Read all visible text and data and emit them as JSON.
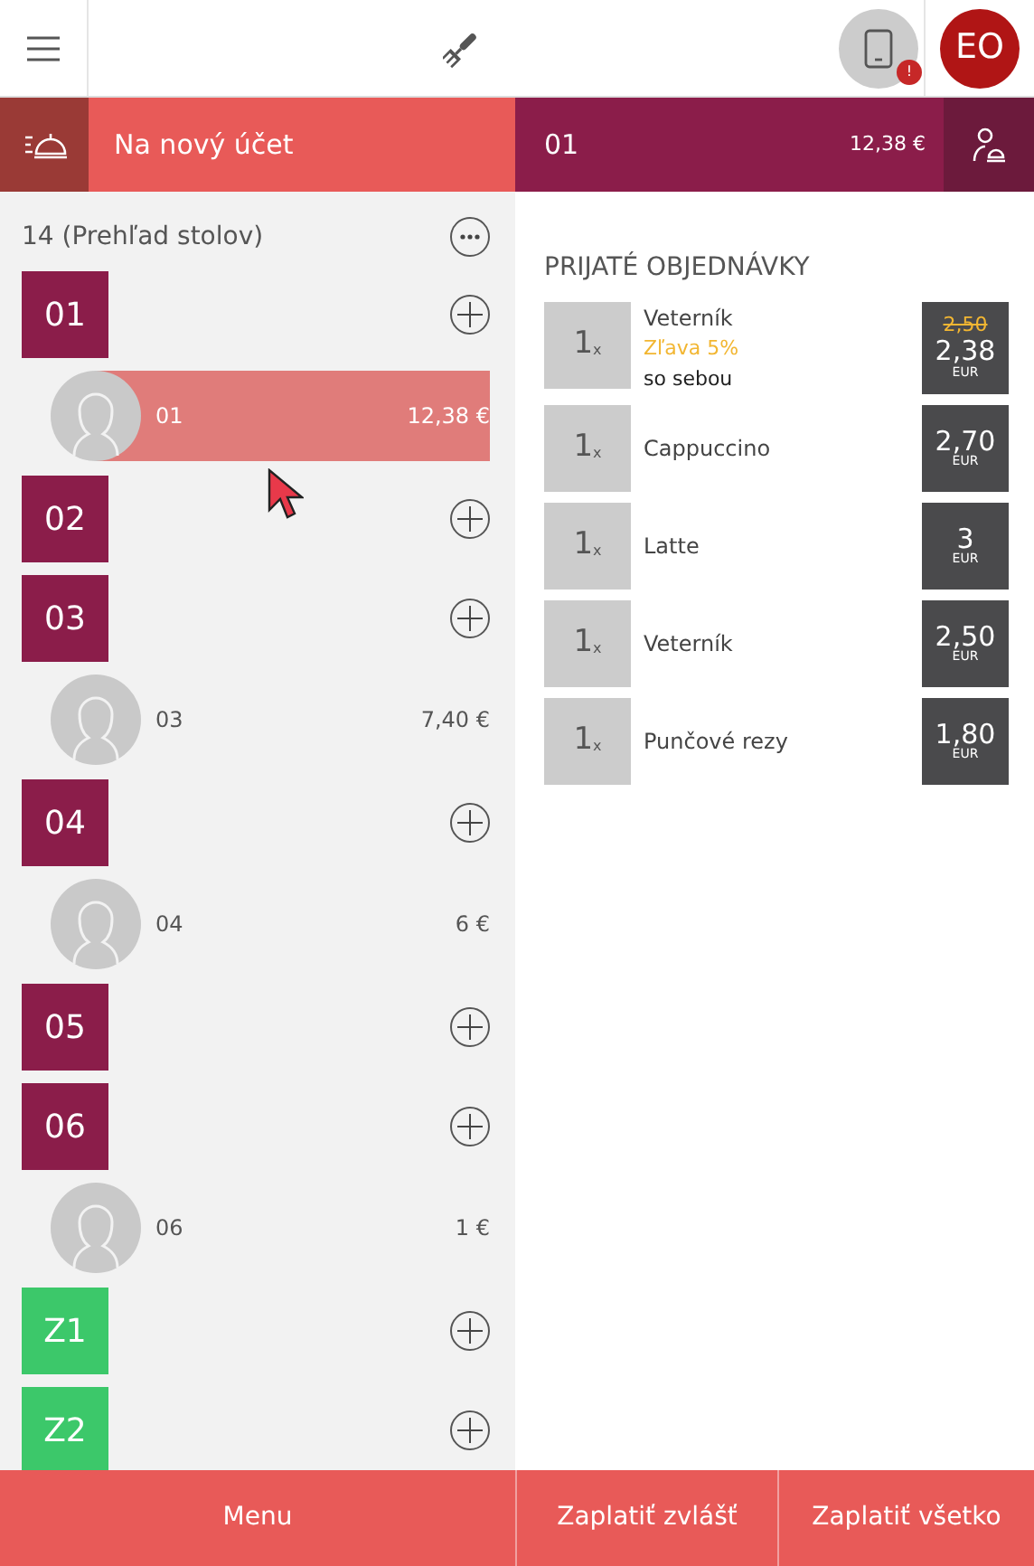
{
  "top_bar": {
    "notification_badge": "!",
    "user_initials": "EO"
  },
  "account_bar": {
    "new_account_label": "Na nový účet",
    "current_account": "01",
    "current_total": "12,38 €"
  },
  "tables_panel": {
    "title": "14 (Prehľad stolov)",
    "tables": [
      {
        "label": "01",
        "color": "#8b1d4a",
        "accounts": [
          {
            "name": "01",
            "total": "12,38 €",
            "selected": true
          }
        ]
      },
      {
        "label": "02",
        "color": "#8b1d4a"
      },
      {
        "label": "03",
        "color": "#8b1d4a",
        "accounts": [
          {
            "name": "03",
            "total": "7,40 €",
            "selected": false
          }
        ]
      },
      {
        "label": "04",
        "color": "#8b1d4a",
        "accounts": [
          {
            "name": "04",
            "total": "6 €",
            "selected": false
          }
        ]
      },
      {
        "label": "05",
        "color": "#8b1d4a"
      },
      {
        "label": "06",
        "color": "#8b1d4a",
        "accounts": [
          {
            "name": "06",
            "total": "1 €",
            "selected": false
          }
        ]
      },
      {
        "label": "Z1",
        "color": "#3cc86a"
      },
      {
        "label": "Z2",
        "color": "#3cc86a"
      }
    ]
  },
  "orders": {
    "title": "PRIJATÉ OBJEDNÁVKY",
    "items": [
      {
        "quantity": "1",
        "unit": "x",
        "name": "Veterník",
        "discount": "Zľava 5%",
        "note": "so sebou",
        "old_price": "2,50",
        "price": "2,38",
        "currency": "EUR"
      },
      {
        "quantity": "1",
        "unit": "x",
        "name": "Cappuccino",
        "price": "2,70",
        "currency": "EUR"
      },
      {
        "quantity": "1",
        "unit": "x",
        "name": "Latte",
        "price": "3",
        "currency": "EUR"
      },
      {
        "quantity": "1",
        "unit": "x",
        "name": "Veterník",
        "price": "2,50",
        "currency": "EUR"
      },
      {
        "quantity": "1",
        "unit": "x",
        "name": "Punčové rezy",
        "price": "1,80",
        "currency": "EUR"
      }
    ]
  },
  "bottom_bar": {
    "buttons": [
      "Menu",
      "Zaplatiť zvlášť",
      "Zaplatiť všetko"
    ]
  }
}
